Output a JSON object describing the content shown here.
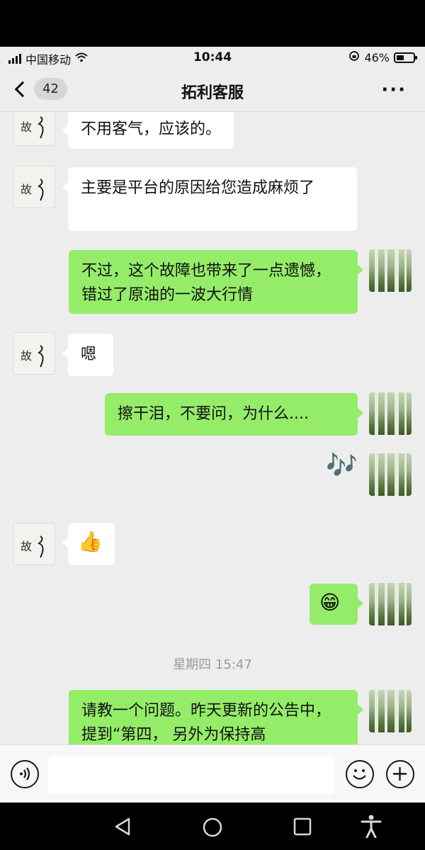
{
  "status_bar": {
    "carrier": "中国移动",
    "time": "10:44",
    "battery_percent": "46%",
    "battery_level": 0.46
  },
  "nav": {
    "back_count": "42",
    "title": "拓利客服",
    "more": "···"
  },
  "messages": [
    {
      "side": "left",
      "text": "不用客气，应该的。"
    },
    {
      "side": "left",
      "text": "主要是平台的原因给您造成麻烦了"
    },
    {
      "side": "right",
      "text": "不过，这个故障也带来了一点遗憾，错过了原油的一波大行情"
    },
    {
      "side": "left",
      "text": "嗯"
    },
    {
      "side": "right",
      "text": "擦干泪，不要问，为什么...."
    },
    {
      "side": "right",
      "sticker": "🎶"
    },
    {
      "side": "left",
      "emoji": "👍"
    },
    {
      "side": "right",
      "emoji": "😁"
    },
    {
      "timestamp": "星期四 15:47"
    },
    {
      "side": "right",
      "text": "请教一个问题。昨天更新的公告中，提到“第四， 另外为保持高"
    }
  ],
  "input_bar": {
    "voice_icon": "voice-icon",
    "emoji_icon": "emoji-icon",
    "plus_icon": "plus-icon",
    "placeholder": ""
  },
  "colors": {
    "chat_bg": "#ededed",
    "bubble_right": "#95ec69",
    "bubble_left": "#ffffff"
  }
}
